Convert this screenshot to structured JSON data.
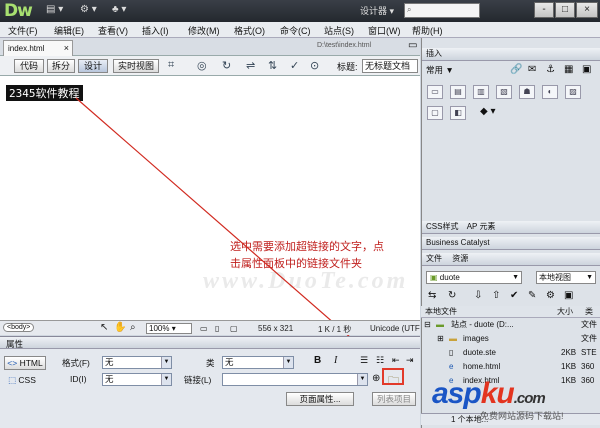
{
  "app": {
    "logo": "Dw",
    "workspace": "设计器",
    "window_buttons": [
      "-",
      "□",
      "×"
    ]
  },
  "menubar": [
    "文件(F)",
    "编辑(E)",
    "查看(V)",
    "插入(I)",
    "修改(M)",
    "格式(O)",
    "命令(C)",
    "站点(S)",
    "窗口(W)",
    "帮助(H)"
  ],
  "document": {
    "tab_name": "index.html",
    "path": "D:\\test\\index.html",
    "view_buttons": [
      "代码",
      "拆分",
      "设计",
      "实时视图"
    ],
    "title_label": "标题:",
    "title_value": "无标题文档",
    "selected_text": "2345软件教程",
    "watermark": "www.DuoTe.com",
    "annotation": "选中需要添加超链接的文字，点击属性面板中的链接文件夹"
  },
  "status_bar": {
    "tag": "<body>",
    "zoom": "100%",
    "dimensions": "556 x 321",
    "size_time": "1 K / 1 秒",
    "encoding": "Unicode (UTF"
  },
  "properties": {
    "title": "属性",
    "html_button": "HTML",
    "css_button": "CSS",
    "format_label": "格式(F)",
    "format_value": "无",
    "class_label": "类",
    "class_value": "无",
    "id_label": "ID(I)",
    "id_value": "无",
    "link_label": "链接(L)",
    "link_value": "",
    "bold": "B",
    "italic": "I",
    "page_props": "页面属性...",
    "list_item": "列表项目"
  },
  "right_panel": {
    "insert_title": "插入",
    "insert_category": "常用",
    "css_tabs": [
      "CSS样式",
      "AP 元素"
    ],
    "bc_title": "Business Catalyst",
    "files_tabs": [
      "文件",
      "资源"
    ],
    "site_select": "duote",
    "view_select": "本地视图",
    "files_header": [
      "本地文件",
      "大小",
      "类"
    ],
    "file_rows": [
      {
        "name": "站点 - duote (D:...",
        "size": "",
        "type": "文件"
      },
      {
        "name": "images",
        "size": "",
        "type": "文件"
      },
      {
        "name": "duote.ste",
        "size": "2KB",
        "type": "STE"
      },
      {
        "name": "home.html",
        "size": "1KB",
        "type": "360"
      },
      {
        "name": "index.html",
        "size": "1KB",
        "type": "360"
      }
    ],
    "footer_text": "1 个本地..."
  },
  "overlay": {
    "logo_a": "asp",
    "logo_b": "ku",
    "logo_c": ".com",
    "subtitle": "免费网站源码下载站!"
  },
  "colors": {
    "annotation": "#c0201e",
    "highlight_box": "#e23a2a"
  }
}
